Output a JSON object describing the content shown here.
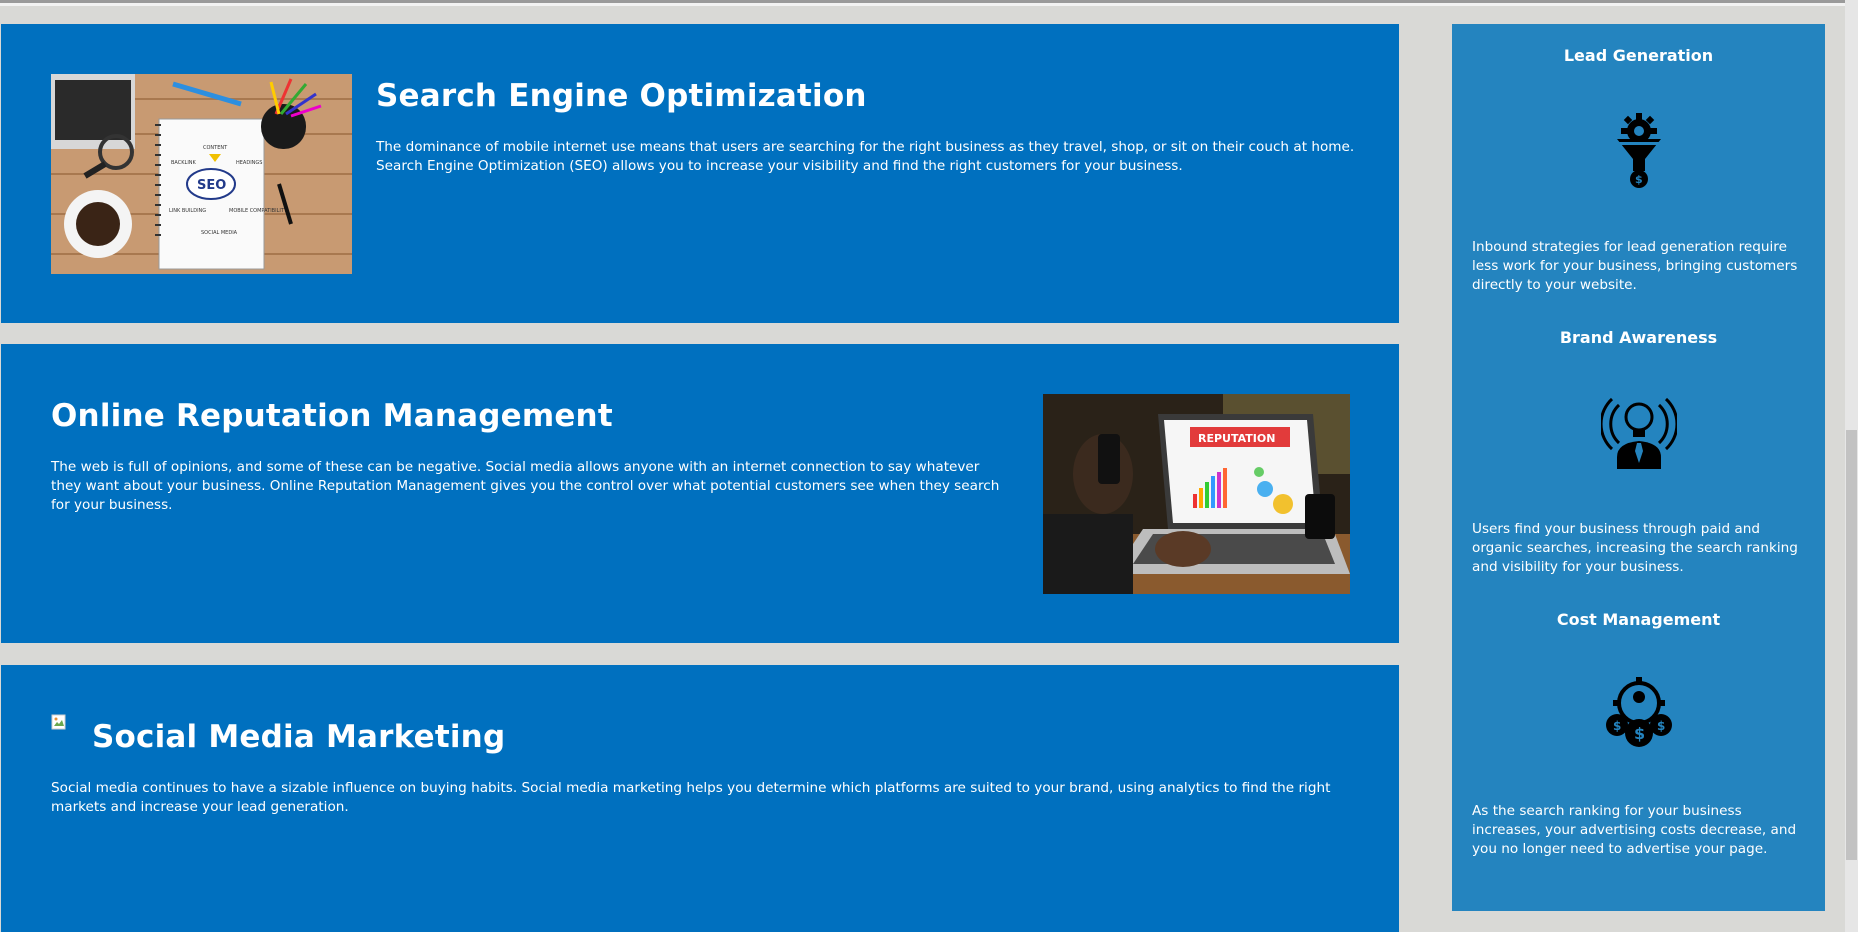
{
  "sections": [
    {
      "title": "Search Engine Optimization",
      "body": "The dominance of mobile internet use means that users are searching for the right business as they travel, shop, or sit on their couch at home. Search Engine Optimization (SEO) allows you to increase your visibility and find the right customers for your business.",
      "image_labels": [
        "CONTENT",
        "BACKLINK",
        "HEADINGS",
        "SEO",
        "LINK BUILDING",
        "MOBILE COMPATIBILITY",
        "SOCIAL MEDIA"
      ]
    },
    {
      "title": "Online Reputation Management",
      "body": "The web is full of opinions, and some of these can be negative. Social media allows anyone with an internet connection to say whatever they want about your business. Online Reputation Management gives you the control over what potential customers see when they search for your business.",
      "image_labels": [
        "REPUTATION"
      ]
    },
    {
      "title": "Social Media Marketing",
      "body": "Social media continues to have a sizable influence on buying habits. Social media marketing helps you determine which platforms are suited to your brand, using analytics to find the right markets and increase your lead generation."
    }
  ],
  "sidebar": {
    "features": [
      {
        "title": "Lead Generation",
        "icon": "funnel-gear-dollar-icon",
        "body": "Inbound strategies for lead generation require less work for your business, bringing customers directly to your website."
      },
      {
        "title": "Brand Awareness",
        "icon": "lightbulb-head-broadcast-icon",
        "body": "Users find your business through paid and organic searches, increasing the search ranking and visibility for your business."
      },
      {
        "title": "Cost Management",
        "icon": "gear-coins-dollar-icon",
        "body": "As the search ranking for your business increases, your advertising costs decrease, and you no longer need to advertise your page."
      }
    ]
  },
  "colors": {
    "section_bg": "#0070bf",
    "sidebar_bg": "#2484bf",
    "page_bg": "#d9d9d6"
  }
}
